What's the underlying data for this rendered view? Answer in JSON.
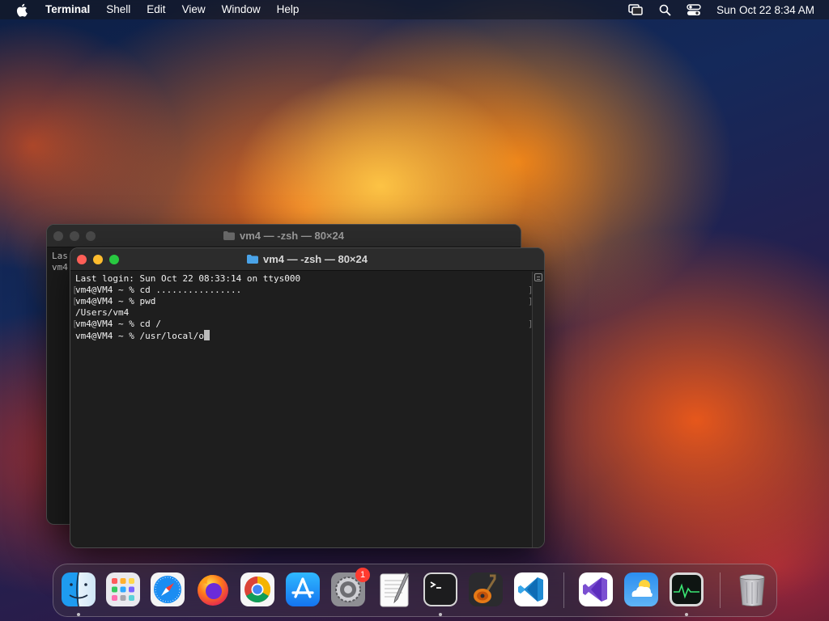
{
  "menubar": {
    "app_name": "Terminal",
    "menus": [
      "Shell",
      "Edit",
      "View",
      "Window",
      "Help"
    ],
    "clock": "Sun Oct 22  8:34 AM",
    "status_icons": [
      "screen-mirroring-icon",
      "spotlight-search-icon",
      "control-center-icon"
    ]
  },
  "back_window": {
    "title": "vm4 — -zsh — 80×24",
    "lines": [
      "Las",
      "vm4"
    ]
  },
  "front_window": {
    "title": "vm4 — -zsh — 80×24",
    "lines": [
      "Last login: Sun Oct 22 08:33:14 on ttys000",
      "vm4@VM4 ~ % cd ................",
      "vm4@VM4 ~ % pwd",
      "/Users/vm4",
      "vm4@VM4 ~ % cd /",
      "vm4@VM4 ~ % /usr/local/o"
    ]
  },
  "dock": {
    "apps": [
      {
        "name": "Finder",
        "icon": "finder-icon",
        "running": true
      },
      {
        "name": "Launchpad",
        "icon": "launchpad-icon",
        "running": false
      },
      {
        "name": "Safari",
        "icon": "safari-icon",
        "running": false
      },
      {
        "name": "Firefox",
        "icon": "firefox-icon",
        "running": false
      },
      {
        "name": "Chrome",
        "icon": "chrome-icon",
        "running": false
      },
      {
        "name": "App Store",
        "icon": "app-store-icon",
        "running": false
      },
      {
        "name": "System Settings",
        "icon": "system-settings-icon",
        "running": false,
        "badge": "1"
      },
      {
        "name": "TextEdit",
        "icon": "textedit-icon",
        "running": false
      },
      {
        "name": "Terminal",
        "icon": "terminal-icon",
        "running": true
      },
      {
        "name": "GarageBand",
        "icon": "garageband-icon",
        "running": false
      },
      {
        "name": "Visual Studio Code",
        "icon": "vscode-icon",
        "running": false
      },
      {
        "name": "Visual Studio",
        "icon": "visual-studio-icon",
        "running": false
      },
      {
        "name": "Weather",
        "icon": "weather-icon",
        "running": false
      },
      {
        "name": "Activity Monitor",
        "icon": "activity-monitor-icon",
        "running": true
      },
      {
        "name": "Trash",
        "icon": "trash-icon",
        "running": false
      }
    ]
  },
  "colors": {
    "close": "#ff5f57",
    "minimize": "#febc2e",
    "zoom": "#28c840",
    "terminal_bg": "#1e1e1e"
  }
}
